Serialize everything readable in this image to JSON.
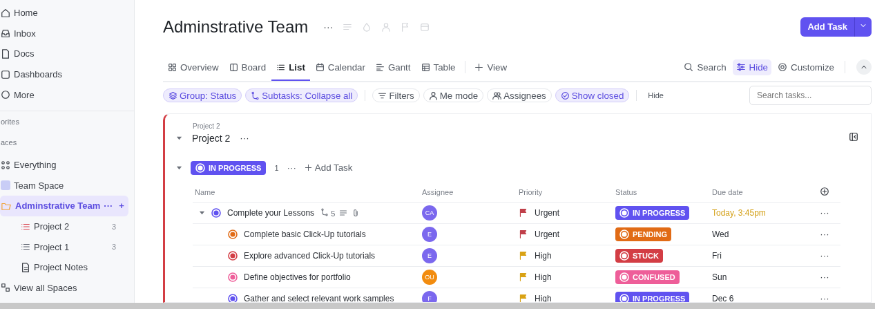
{
  "sidebar": {
    "nav": [
      {
        "label": "Home"
      },
      {
        "label": "Inbox"
      },
      {
        "label": "Docs"
      },
      {
        "label": "Dashboards"
      },
      {
        "label": "More"
      }
    ],
    "sections": [
      "orites",
      "aces"
    ],
    "spaces": [
      {
        "label": "Everything",
        "kind": "everything",
        "selected": false
      },
      {
        "label": "Team Space",
        "kind": "space",
        "selected": false
      },
      {
        "label": "Adminstrative Team",
        "kind": "folder",
        "selected": true,
        "more": "···",
        "add": "+",
        "children": [
          {
            "label": "Project 2",
            "kind": "list",
            "color": "#d9414b",
            "count": "3"
          },
          {
            "label": "Project 1",
            "kind": "list",
            "color": "#5a5f6b",
            "count": "3"
          },
          {
            "label": "Project Notes",
            "kind": "doc"
          }
        ]
      },
      {
        "label": "View all Spaces",
        "kind": "all",
        "selected": false
      }
    ]
  },
  "header": {
    "title": "Adminstrative Team",
    "more": "···",
    "add_task": "Add Task",
    "tabs": [
      {
        "label": "Overview",
        "selected": false
      },
      {
        "label": "Board",
        "selected": false
      },
      {
        "label": "List",
        "selected": true
      },
      {
        "label": "Calendar",
        "selected": false
      },
      {
        "label": "Gantt",
        "selected": false
      },
      {
        "label": "Table",
        "selected": false
      }
    ],
    "add_view": "View",
    "actions": [
      {
        "label": "Search",
        "selected": false
      },
      {
        "label": "Hide",
        "selected": true
      },
      {
        "label": "Customize",
        "selected": false
      }
    ],
    "filters": [
      {
        "label": "Group: Status",
        "active": true
      },
      {
        "label": "Subtasks: Collapse all",
        "active": true
      },
      {
        "label": "Filters",
        "active": false
      },
      {
        "label": "Me mode",
        "active": false
      },
      {
        "label": "Assignees",
        "active": false
      },
      {
        "label": "Show closed",
        "active": true
      }
    ],
    "hide": "Hide",
    "search_placeholder": "Search tasks..."
  },
  "list": {
    "breadcrumb": "Project 2",
    "name": "Project 2",
    "more": "···",
    "expanded": true,
    "group": {
      "status": "IN PROGRESS",
      "color": "#6052f0",
      "count": "1",
      "more": "···",
      "add": "Add Task",
      "expanded": true
    },
    "columns": [
      "Name",
      "Assignee",
      "Priority",
      "Status",
      "Due date"
    ],
    "rows": [
      {
        "name": "Complete your Lessons",
        "subtask": false,
        "expanded": true,
        "subtasks": "5",
        "dot": {
          "color": "#6052f0"
        },
        "assignee": {
          "initials": "CA",
          "color": "#7b68ee"
        },
        "priority": {
          "label": "Urgent",
          "color": "#c0404a"
        },
        "status": {
          "label": "IN PROGRESS",
          "color": "#6052f0"
        },
        "due": "Today, 3:45pm",
        "due_today": true,
        "more": "···"
      },
      {
        "name": "Complete basic Click-Up tutorials",
        "subtask": true,
        "dot": {
          "color": "#e16b16"
        },
        "assignee": {
          "initials": "E",
          "color": "#7b68ee"
        },
        "priority": {
          "label": "Urgent",
          "color": "#c0404a"
        },
        "status": {
          "label": "PENDING",
          "color": "#e16b16"
        },
        "due": "Wed",
        "due_today": false,
        "more": "···"
      },
      {
        "name": "Explore advanced Click-Up tutorials",
        "subtask": true,
        "dot": {
          "color": "#d33d44"
        },
        "assignee": {
          "initials": "E",
          "color": "#7b68ee"
        },
        "priority": {
          "label": "High",
          "color": "#d9a214"
        },
        "status": {
          "label": "STUCK",
          "color": "#d33d44"
        },
        "due": "Fri",
        "due_today": false,
        "more": "···"
      },
      {
        "name": "Define objectives for portfolio",
        "subtask": true,
        "dot": {
          "color": "#ee5e99"
        },
        "assignee": {
          "initials": "OU",
          "color": "#f28c0f"
        },
        "priority": {
          "label": "High",
          "color": "#d9a214"
        },
        "status": {
          "label": "CONFUSED",
          "color": "#ee5e99"
        },
        "due": "Sun",
        "due_today": false,
        "more": "···"
      },
      {
        "name": "Gather and select relevant work samples",
        "subtask": true,
        "dot": {
          "color": "#6052f0"
        },
        "assignee": {
          "initials": "F",
          "color": "#7b68ee"
        },
        "priority": {
          "label": "High",
          "color": "#d9a214"
        },
        "status": {
          "label": "IN PROGRESS",
          "color": "#6052f0"
        },
        "due": "Dec 6",
        "due_today": false,
        "more": "···"
      }
    ]
  }
}
